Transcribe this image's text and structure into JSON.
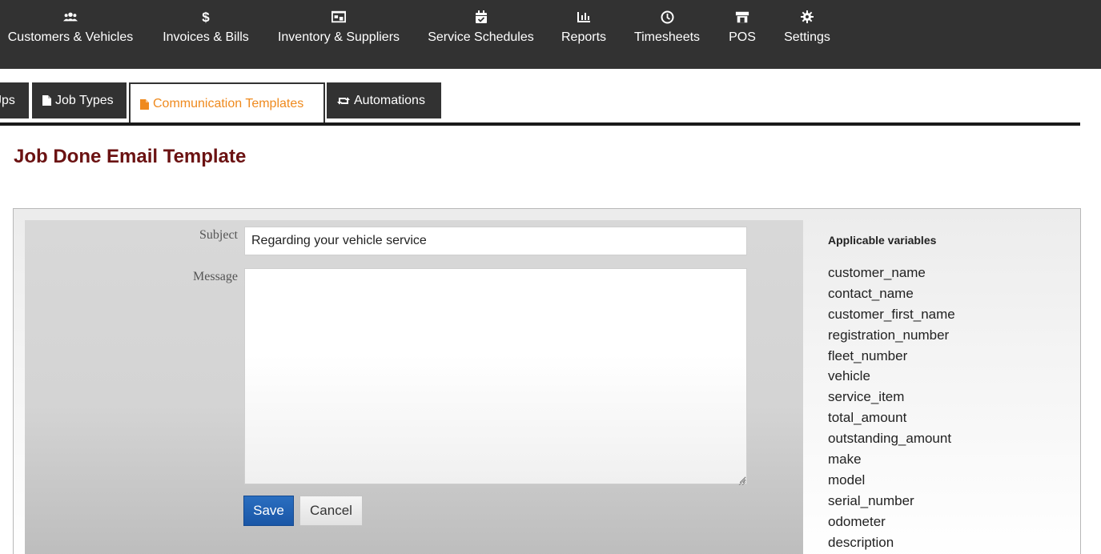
{
  "nav": {
    "items": [
      {
        "label": "Customers & Vehicles",
        "icon": "users-icon"
      },
      {
        "label": "Invoices & Bills",
        "icon": "dollar-icon"
      },
      {
        "label": "Inventory & Suppliers",
        "icon": "warehouse-icon"
      },
      {
        "label": "Service Schedules",
        "icon": "calendar-check-icon"
      },
      {
        "label": "Reports",
        "icon": "bar-chart-icon"
      },
      {
        "label": "Timesheets",
        "icon": "clock-icon"
      },
      {
        "label": "POS",
        "icon": "store-icon"
      },
      {
        "label": "Settings",
        "icon": "gear-icon"
      }
    ]
  },
  "tabs": {
    "items": [
      {
        "label": "Jps",
        "icon": ""
      },
      {
        "label": "Job Types",
        "icon": "file-icon"
      },
      {
        "label": "Communication Templates",
        "icon": "file-icon",
        "active": true
      },
      {
        "label": "Automations",
        "icon": "retweet-icon"
      }
    ]
  },
  "page": {
    "title": "Job Done Email Template"
  },
  "form": {
    "subject_label": "Subject",
    "subject_value": "Regarding your vehicle service",
    "message_label": "Message",
    "message_value": "",
    "save_label": "Save",
    "cancel_label": "Cancel"
  },
  "variables": {
    "title": "Applicable variables",
    "items": [
      "customer_name",
      "contact_name",
      "customer_first_name",
      "registration_number",
      "fleet_number",
      "vehicle",
      "service_item",
      "total_amount",
      "outstanding_amount",
      "make",
      "model",
      "serial_number",
      "odometer",
      "description"
    ]
  },
  "colors": {
    "nav_bg": "#323232",
    "active_tab": "#ef8a1e",
    "title": "#6b1212",
    "save_button": "#1a56a6"
  }
}
